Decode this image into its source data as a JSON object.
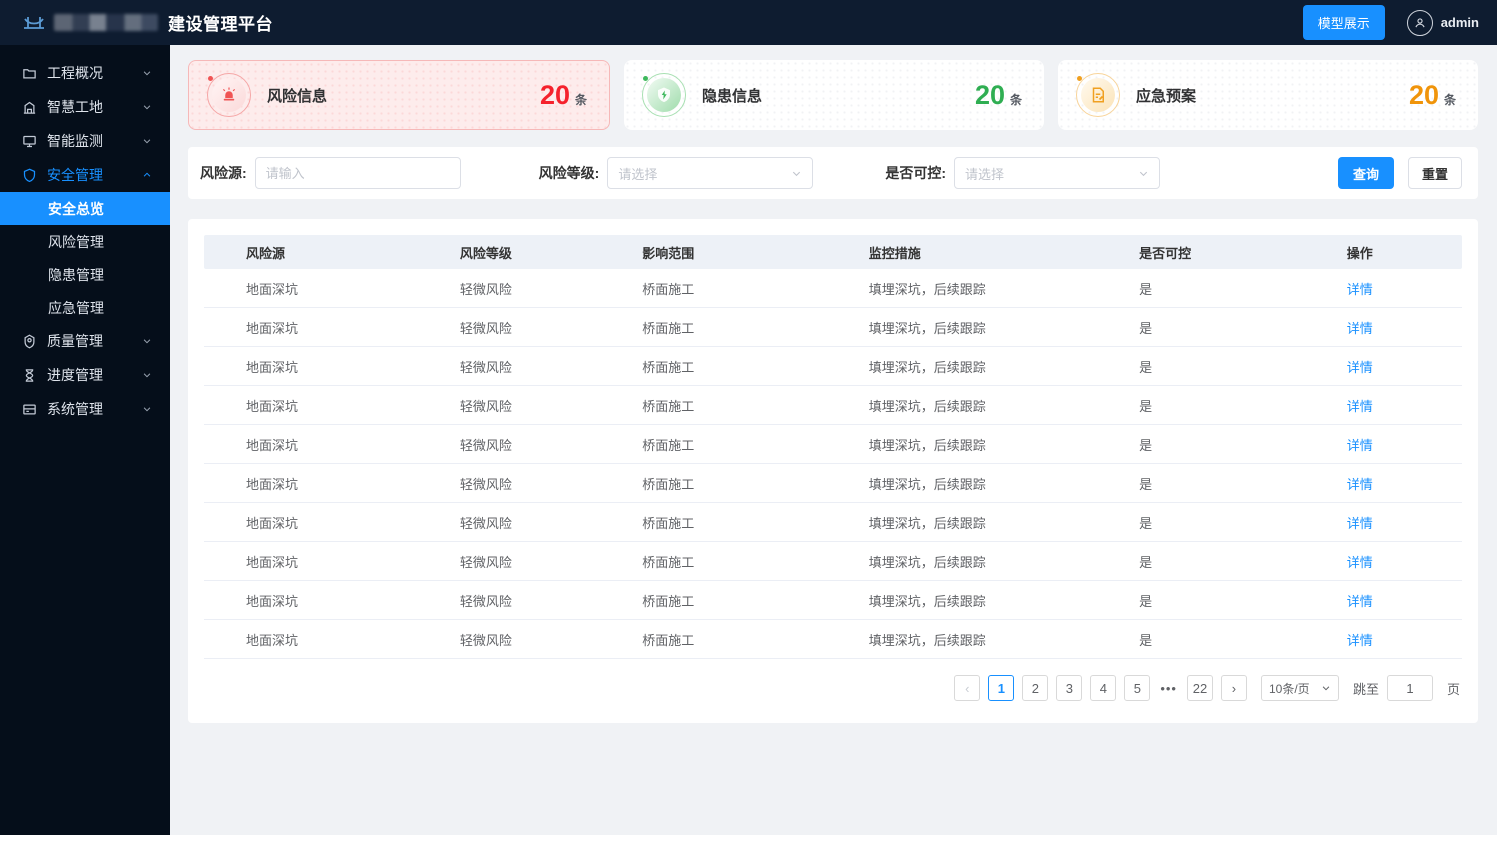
{
  "header": {
    "app_title": "建设管理平台",
    "model_button": "模型展示",
    "username": "admin"
  },
  "sidebar": {
    "items": [
      {
        "label": "工程概况",
        "icon": "folder-icon"
      },
      {
        "label": "智慧工地",
        "icon": "site-icon"
      },
      {
        "label": "智能监测",
        "icon": "monitor-icon"
      },
      {
        "label": "安全管理",
        "icon": "shield-icon",
        "expanded": true,
        "children": [
          "安全总览",
          "风险管理",
          "隐患管理",
          "应急管理"
        ],
        "active_child": "安全总览"
      },
      {
        "label": "质量管理",
        "icon": "quality-icon"
      },
      {
        "label": "进度管理",
        "icon": "progress-icon"
      },
      {
        "label": "系统管理",
        "icon": "system-icon"
      }
    ]
  },
  "stat_cards": [
    {
      "label": "风险信息",
      "value": "20",
      "unit": "条",
      "color": "#f5222d",
      "icon": "alarm-icon"
    },
    {
      "label": "隐患信息",
      "value": "20",
      "unit": "条",
      "color": "#3eb85c",
      "icon": "shield-check-icon"
    },
    {
      "label": "应急预案",
      "value": "20",
      "unit": "条",
      "color": "#f0a020",
      "icon": "document-edit-icon"
    }
  ],
  "filters": {
    "risk_source_label": "风险源:",
    "risk_source_placeholder": "请输入",
    "risk_level_label": "风险等级:",
    "risk_level_placeholder": "请选择",
    "controllable_label": "是否可控:",
    "controllable_placeholder": "请选择",
    "search_button": "查询",
    "reset_button": "重置"
  },
  "table": {
    "columns": [
      "风险源",
      "风险等级",
      "影响范围",
      "监控措施",
      "是否可控",
      "操作"
    ],
    "rows": [
      {
        "risk_source": "地面深坑",
        "risk_level": "轻微风险",
        "impact_scope": "桥面施工",
        "monitoring": "填埋深坑，后续跟踪",
        "controllable": "是",
        "action": "详情"
      },
      {
        "risk_source": "地面深坑",
        "risk_level": "轻微风险",
        "impact_scope": "桥面施工",
        "monitoring": "填埋深坑，后续跟踪",
        "controllable": "是",
        "action": "详情"
      },
      {
        "risk_source": "地面深坑",
        "risk_level": "轻微风险",
        "impact_scope": "桥面施工",
        "monitoring": "填埋深坑，后续跟踪",
        "controllable": "是",
        "action": "详情"
      },
      {
        "risk_source": "地面深坑",
        "risk_level": "轻微风险",
        "impact_scope": "桥面施工",
        "monitoring": "填埋深坑，后续跟踪",
        "controllable": "是",
        "action": "详情"
      },
      {
        "risk_source": "地面深坑",
        "risk_level": "轻微风险",
        "impact_scope": "桥面施工",
        "monitoring": "填埋深坑，后续跟踪",
        "controllable": "是",
        "action": "详情"
      },
      {
        "risk_source": "地面深坑",
        "risk_level": "轻微风险",
        "impact_scope": "桥面施工",
        "monitoring": "填埋深坑，后续跟踪",
        "controllable": "是",
        "action": "详情"
      },
      {
        "risk_source": "地面深坑",
        "risk_level": "轻微风险",
        "impact_scope": "桥面施工",
        "monitoring": "填埋深坑，后续跟踪",
        "controllable": "是",
        "action": "详情"
      },
      {
        "risk_source": "地面深坑",
        "risk_level": "轻微风险",
        "impact_scope": "桥面施工",
        "monitoring": "填埋深坑，后续跟踪",
        "controllable": "是",
        "action": "详情"
      },
      {
        "risk_source": "地面深坑",
        "risk_level": "轻微风险",
        "impact_scope": "桥面施工",
        "monitoring": "填埋深坑，后续跟踪",
        "controllable": "是",
        "action": "详情"
      },
      {
        "risk_source": "地面深坑",
        "risk_level": "轻微风险",
        "impact_scope": "桥面施工",
        "monitoring": "填埋深坑，后续跟踪",
        "controllable": "是",
        "action": "详情"
      }
    ]
  },
  "pagination": {
    "prev": "‹",
    "pages": [
      "1",
      "2",
      "3",
      "4",
      "5"
    ],
    "active_page": "1",
    "ellipsis": "•••",
    "last_page": "22",
    "next": "›",
    "page_size": "10条/页",
    "jump_prefix": "跳至",
    "jump_value": "1",
    "jump_suffix": "页"
  }
}
